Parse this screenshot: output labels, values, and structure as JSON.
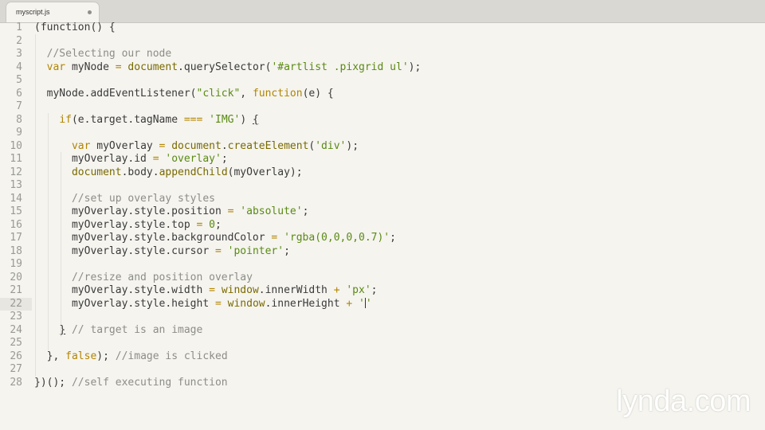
{
  "tab": {
    "title": "myscript.js"
  },
  "watermark": "lynda.com",
  "current_line": 22,
  "lines": [
    {
      "n": "1",
      "tokens": [
        [
          "plain",
          "(function() {"
        ]
      ]
    },
    {
      "n": "2",
      "tokens": []
    },
    {
      "n": "3",
      "tokens": [
        [
          "plain",
          "  "
        ],
        [
          "comment",
          "//Selecting our node"
        ]
      ]
    },
    {
      "n": "4",
      "tokens": [
        [
          "plain",
          "  "
        ],
        [
          "keyword",
          "var"
        ],
        [
          "plain",
          " myNode "
        ],
        [
          "op",
          "="
        ],
        [
          "plain",
          " "
        ],
        [
          "fn",
          "document"
        ],
        [
          "plain",
          ".querySelector("
        ],
        [
          "string",
          "'#artlist .pixgrid ul'"
        ],
        [
          "plain",
          ");"
        ]
      ]
    },
    {
      "n": "5",
      "tokens": []
    },
    {
      "n": "6",
      "tokens": [
        [
          "plain",
          "  myNode.addEventListener("
        ],
        [
          "string",
          "\"click\""
        ],
        [
          "plain",
          ", "
        ],
        [
          "keyword",
          "function"
        ],
        [
          "plain",
          "(e) {"
        ]
      ]
    },
    {
      "n": "7",
      "tokens": []
    },
    {
      "n": "8",
      "tokens": [
        [
          "plain",
          "    "
        ],
        [
          "keyword",
          "if"
        ],
        [
          "plain",
          "(e.target.tagName "
        ],
        [
          "op",
          "==="
        ],
        [
          "plain",
          " "
        ],
        [
          "string",
          "'IMG'"
        ],
        [
          "plain",
          ") "
        ],
        [
          "bracket",
          "{"
        ]
      ]
    },
    {
      "n": "9",
      "tokens": []
    },
    {
      "n": "10",
      "tokens": [
        [
          "plain",
          "      "
        ],
        [
          "keyword",
          "var"
        ],
        [
          "plain",
          " myOverlay "
        ],
        [
          "op",
          "="
        ],
        [
          "plain",
          " "
        ],
        [
          "fn",
          "document"
        ],
        [
          "plain",
          "."
        ],
        [
          "fn",
          "createElement"
        ],
        [
          "plain",
          "("
        ],
        [
          "string",
          "'div'"
        ],
        [
          "plain",
          ");"
        ]
      ]
    },
    {
      "n": "11",
      "tokens": [
        [
          "plain",
          "      myOverlay.id "
        ],
        [
          "op",
          "="
        ],
        [
          "plain",
          " "
        ],
        [
          "string",
          "'overlay'"
        ],
        [
          "plain",
          ";"
        ]
      ]
    },
    {
      "n": "12",
      "tokens": [
        [
          "plain",
          "      "
        ],
        [
          "fn",
          "document"
        ],
        [
          "plain",
          ".body."
        ],
        [
          "fn",
          "appendChild"
        ],
        [
          "plain",
          "(myOverlay);"
        ]
      ]
    },
    {
      "n": "13",
      "tokens": []
    },
    {
      "n": "14",
      "tokens": [
        [
          "plain",
          "      "
        ],
        [
          "comment",
          "//set up overlay styles"
        ]
      ]
    },
    {
      "n": "15",
      "tokens": [
        [
          "plain",
          "      myOverlay.style.position "
        ],
        [
          "op",
          "="
        ],
        [
          "plain",
          " "
        ],
        [
          "string",
          "'absolute'"
        ],
        [
          "plain",
          ";"
        ]
      ]
    },
    {
      "n": "16",
      "tokens": [
        [
          "plain",
          "      myOverlay.style.top "
        ],
        [
          "op",
          "="
        ],
        [
          "plain",
          " "
        ],
        [
          "string",
          "0"
        ],
        [
          "plain",
          ";"
        ]
      ]
    },
    {
      "n": "17",
      "tokens": [
        [
          "plain",
          "      myOverlay.style.backgroundColor "
        ],
        [
          "op",
          "="
        ],
        [
          "plain",
          " "
        ],
        [
          "string",
          "'rgba(0,0,0,0.7)'"
        ],
        [
          "plain",
          ";"
        ]
      ]
    },
    {
      "n": "18",
      "tokens": [
        [
          "plain",
          "      myOverlay.style.cursor "
        ],
        [
          "op",
          "="
        ],
        [
          "plain",
          " "
        ],
        [
          "string",
          "'pointer'"
        ],
        [
          "plain",
          ";"
        ]
      ]
    },
    {
      "n": "19",
      "tokens": []
    },
    {
      "n": "20",
      "tokens": [
        [
          "plain",
          "      "
        ],
        [
          "comment",
          "//resize and position overlay"
        ]
      ]
    },
    {
      "n": "21",
      "tokens": [
        [
          "plain",
          "      myOverlay.style.width "
        ],
        [
          "op",
          "="
        ],
        [
          "plain",
          " "
        ],
        [
          "fn",
          "window"
        ],
        [
          "plain",
          ".innerWidth "
        ],
        [
          "op",
          "+"
        ],
        [
          "plain",
          " "
        ],
        [
          "string",
          "'px'"
        ],
        [
          "plain",
          ";"
        ]
      ]
    },
    {
      "n": "22",
      "tokens": [
        [
          "plain",
          "      myOverlay.style.height "
        ],
        [
          "op",
          "="
        ],
        [
          "plain",
          " "
        ],
        [
          "fn",
          "window"
        ],
        [
          "plain",
          ".innerHeight "
        ],
        [
          "op",
          "+"
        ],
        [
          "plain",
          " "
        ],
        [
          "string",
          "'"
        ],
        [
          "caret",
          ""
        ],
        [
          "string",
          "'"
        ]
      ]
    },
    {
      "n": "23",
      "tokens": []
    },
    {
      "n": "24",
      "tokens": [
        [
          "plain",
          "    "
        ],
        [
          "bracket",
          "}"
        ],
        [
          "plain",
          " "
        ],
        [
          "comment",
          "// target is an image"
        ]
      ]
    },
    {
      "n": "25",
      "tokens": []
    },
    {
      "n": "26",
      "tokens": [
        [
          "plain",
          "  }, "
        ],
        [
          "keyword",
          "false"
        ],
        [
          "plain",
          "); "
        ],
        [
          "comment",
          "//image is clicked"
        ]
      ]
    },
    {
      "n": "27",
      "tokens": []
    },
    {
      "n": "28",
      "tokens": [
        [
          "plain",
          "})(); "
        ],
        [
          "comment",
          "//self executing function"
        ]
      ]
    }
  ]
}
